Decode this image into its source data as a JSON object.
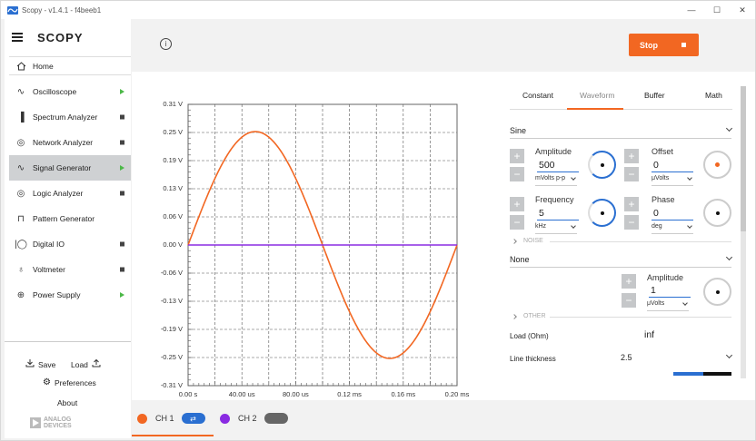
{
  "window": {
    "title": "Scopy - v1.4.1 - f4beeb1",
    "minimize_glyph": "—",
    "maximize_glyph": "☐",
    "close_glyph": "✕"
  },
  "sidebar": {
    "logo": "SCOPY",
    "home_label": "Home",
    "items": [
      {
        "label": "Oscilloscope",
        "icon": "oscilloscope-icon",
        "glyph": "∿",
        "indicator": "play"
      },
      {
        "label": "Spectrum Analyzer",
        "icon": "spectrum-icon",
        "glyph": "▐",
        "indicator": "stop"
      },
      {
        "label": "Network Analyzer",
        "icon": "network-icon",
        "glyph": "◎",
        "indicator": "stop"
      },
      {
        "label": "Signal Generator",
        "icon": "signal-icon",
        "glyph": "∿",
        "indicator": "play",
        "active": true
      },
      {
        "label": "Logic Analyzer",
        "icon": "logic-icon",
        "glyph": "◎",
        "indicator": "stop"
      },
      {
        "label": "Pattern Generator",
        "icon": "pattern-icon",
        "glyph": "⊓",
        "indicator": "none"
      },
      {
        "label": "Digital IO",
        "icon": "digital-io-icon",
        "glyph": "|◯",
        "indicator": "stop"
      },
      {
        "label": "Voltmeter",
        "icon": "voltmeter-icon",
        "glyph": "♁",
        "indicator": "stop"
      },
      {
        "label": "Power Supply",
        "icon": "power-icon",
        "glyph": "⊕",
        "indicator": "play"
      }
    ],
    "save_label": "Save",
    "load_label": "Load",
    "preferences_label": "Preferences",
    "about_label": "About",
    "brand_line1": "ANALOG",
    "brand_line2": "DEVICES"
  },
  "toolbar": {
    "info_glyph": "i",
    "stop_label": "Stop"
  },
  "plot": {
    "y_ticks": [
      "0.31 V",
      "0.25 V",
      "0.19 V",
      "0.13 V",
      "0.06 V",
      "0.00 V",
      "-0.06 V",
      "-0.13 V",
      "-0.19 V",
      "-0.25 V",
      "-0.31 V"
    ],
    "x_ticks": [
      "0.00 s",
      "40.00 us",
      "80.00 us",
      "0.12 ms",
      "0.16 ms",
      "0.20 ms"
    ]
  },
  "chart_data": {
    "type": "line",
    "title": "",
    "xlabel": "",
    "ylabel": "",
    "xlim": [
      0,
      0.0002
    ],
    "ylim": [
      -0.31,
      0.31
    ],
    "grid": true,
    "series": [
      {
        "name": "CH 1",
        "color": "#f26722",
        "waveform": "sine",
        "amplitude": 0.25,
        "frequency_hz": 5000,
        "phase_deg": 0,
        "offset": 0
      },
      {
        "name": "CH 2",
        "color": "#8a2be2",
        "waveform": "flat",
        "value": 0
      }
    ]
  },
  "channels": [
    {
      "label": "CH 1",
      "color": "#f26722",
      "pill_color": "#2a6fd1",
      "pill_glyph": "⇄"
    },
    {
      "label": "CH 2",
      "color": "#8a2be2",
      "pill_color": "#666666",
      "pill_glyph": ""
    }
  ],
  "panel": {
    "tabs": [
      "Constant",
      "Waveform",
      "Buffer",
      "Math"
    ],
    "active_tab": "Waveform",
    "waveform_type": "Sine",
    "amplitude": {
      "label": "Amplitude",
      "value": "500",
      "unit": "mVolts p-p"
    },
    "offset": {
      "label": "Offset",
      "value": "0",
      "unit": "μVolts"
    },
    "frequency": {
      "label": "Frequency",
      "value": "5",
      "unit": "kHz"
    },
    "phase": {
      "label": "Phase",
      "value": "0",
      "unit": "deg"
    },
    "noise_section": "NOISE",
    "noise_type": "None",
    "noise_amplitude": {
      "label": "Amplitude",
      "value": "1",
      "unit": "μVolts"
    },
    "other_section": "OTHER",
    "load_label": "Load (Ohm)",
    "load_value": "inf",
    "line_thickness_label": "Line thickness",
    "line_thickness_value": "2.5",
    "plus_glyph": "+",
    "minus_glyph": "−"
  }
}
